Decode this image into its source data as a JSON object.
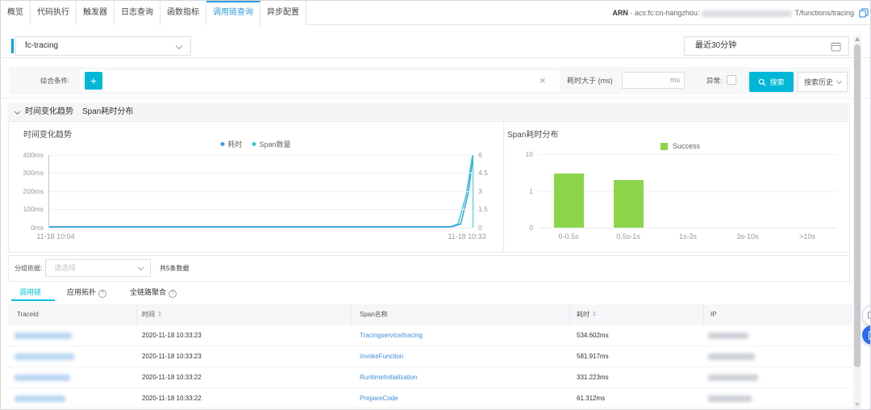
{
  "header": {
    "tabs": [
      {
        "label": "概览",
        "active": false
      },
      {
        "label": "代码执行",
        "active": false
      },
      {
        "label": "触发器",
        "active": false
      },
      {
        "label": "日志查询",
        "active": false
      },
      {
        "label": "函数指标",
        "active": false
      },
      {
        "label": "调用链查询",
        "active": true
      },
      {
        "label": "异步配置",
        "active": false
      }
    ],
    "arn": {
      "label": "ARN",
      "separator": " - ",
      "prefix": "acs:fc:cn-hangzhou:",
      "suffix": "T/functions/tracing"
    }
  },
  "toolbar": {
    "function_select_value": "fc-tracing",
    "time_range_value": "最近30分钟"
  },
  "search": {
    "condition_label": "综合条件:",
    "add_button": "+",
    "duration_label": "耗时大于 (ms)",
    "duration_unit": "ms",
    "exception_label": "异常:",
    "search_button": "搜索",
    "history_button": "搜索历史"
  },
  "trend_section": {
    "collapse_title": "时间变化趋势",
    "collapse_title2": "Span耗时分布"
  },
  "chart_data": [
    {
      "type": "line",
      "title": "时间变化趋势",
      "series": [
        {
          "name": "耗时",
          "color": "#3b9be8",
          "axis": "left",
          "points": [
            [
              0,
              0.012
            ],
            [
              0.952,
              0.012
            ],
            [
              0.972,
              0.05
            ],
            [
              0.99,
              0.48
            ],
            [
              1,
              0.925
            ]
          ]
        },
        {
          "name": "Span数量",
          "color": "#36cbcb",
          "axis": "right",
          "points": [
            [
              0,
              0.006
            ],
            [
              0.945,
              0.006
            ],
            [
              0.966,
              0.05
            ],
            [
              0.985,
              0.45
            ],
            [
              1,
              0.995
            ]
          ]
        }
      ],
      "left_axis_ticks": [
        "400ms",
        "300ms",
        "200ms",
        "100ms",
        "0ms"
      ],
      "right_axis_ticks": [
        "6",
        "4.5",
        "3",
        "1.5",
        "0"
      ],
      "x_labels": [
        "11-18 10:04",
        "11-18 10:33"
      ],
      "ylim_left": [
        0,
        400
      ],
      "ylim_right": [
        0,
        6
      ],
      "grid": true,
      "legend_position": "top"
    },
    {
      "type": "bar",
      "title": "Span耗时分布",
      "legend": [
        {
          "name": "Success",
          "color": "#8cd54a"
        }
      ],
      "categories": [
        "0-0.5s",
        "0.5s-1s",
        "1s-3s",
        "3s-10s",
        ">10s"
      ],
      "values": [
        3,
        2,
        0,
        0,
        0
      ],
      "y_ticks": [
        {
          "label": "10",
          "value": 10
        },
        {
          "label": "1",
          "value": 1
        },
        {
          "label": "0",
          "value": 0
        }
      ],
      "scale": "log",
      "grid": true,
      "legend_position": "top"
    }
  ],
  "grouping": {
    "label": "分组依据:",
    "placeholder": "请选择",
    "total": "共5条数据"
  },
  "result_tabs": [
    {
      "label": "调用链",
      "active": true
    },
    {
      "label": "应用拓扑",
      "help": true
    },
    {
      "label": "全链路聚合",
      "help": true
    }
  ],
  "table": {
    "columns": [
      {
        "label": "TraceId"
      },
      {
        "label": "时间",
        "sortable": true
      },
      {
        "label": "Span名称"
      },
      {
        "label": "耗时",
        "sortable": true
      },
      {
        "label": "IP"
      }
    ],
    "rows": [
      {
        "time": "2020-11-18 10:33:23",
        "span_name": "Tracingservice/tracing",
        "duration": "534.602ms"
      },
      {
        "time": "2020-11-18 10:33:23",
        "span_name": "InvokeFunction",
        "duration": "581.917ms"
      },
      {
        "time": "2020-11-18 10:33:22",
        "span_name": "RuntimeInitialization",
        "duration": "331.223ms"
      },
      {
        "time": "2020-11-18 10:33:22",
        "span_name": "PrepareCode",
        "duration": "61.312ms"
      }
    ]
  }
}
